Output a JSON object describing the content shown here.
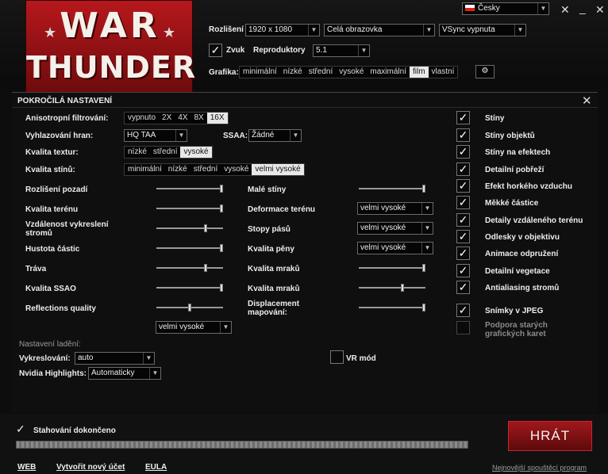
{
  "language": {
    "label": "Česky"
  },
  "header": {
    "logo_line1": "WAR",
    "logo_line2": "THUNDER",
    "resolution_label": "Rozlišení",
    "resolution_value": "1920 x 1080",
    "window_mode_value": "Celá obrazovka",
    "vsync_value": "VSync vypnuta",
    "sound_label": "Zvuk",
    "speakers_label": "Reproduktory",
    "speakers_value": "5.1",
    "graphics_label": "Grafika:",
    "graphics_presets": [
      "minimální",
      "nízké",
      "střední",
      "vysoké",
      "maximální",
      "film",
      "vlastní"
    ],
    "graphics_selected": "film"
  },
  "advanced": {
    "title": "POKROČILÁ NASTAVENÍ",
    "aniso_label": "Anisotropní filtrování:",
    "aniso_options": [
      "vypnuto",
      "2X",
      "4X",
      "8X",
      "16X"
    ],
    "aniso_selected": "16X",
    "aa_label": "Vyhlazování hran:",
    "aa_value": "HQ TAA",
    "ssaa_label": "SSAA:",
    "ssaa_value": "Žádné",
    "texture_label": "Kvalita textur:",
    "texture_options": [
      "nízké",
      "střední",
      "vysoké"
    ],
    "texture_selected": "vysoké",
    "shadow_label": "Kvalita stínů:",
    "shadow_options": [
      "minimální",
      "nízké",
      "střední",
      "vysoké",
      "velmi vysoké"
    ],
    "shadow_selected": "velmi vysoké",
    "left_sliders": [
      {
        "label": "Rozlišení pozadí",
        "value": 1.0
      },
      {
        "label": "Kvalita terénu",
        "value": 1.0
      },
      {
        "label": "Vzdálenost vykreslení stromů",
        "value": 0.75
      },
      {
        "label": "Hustota částic",
        "value": 1.0
      },
      {
        "label": "Tráva",
        "value": 0.75
      },
      {
        "label": "Kvalita SSAO",
        "value": 1.0
      },
      {
        "label": "Reflections quality",
        "value": 0.5
      }
    ],
    "reflections_value": "velmi vysoké",
    "mid": {
      "small_shadows_label": "Malé stíny",
      "small_shadows_value": 1.0,
      "terrain_deform_label": "Deformace terénu",
      "terrain_deform_value": "velmi vysoké",
      "tracks_label": "Stopy pásů",
      "tracks_value": "velmi vysoké",
      "foam_label": "Kvalita pěny",
      "foam_value": "velmi vysoké",
      "clouds1_label": "Kvalita mraků",
      "clouds1_value": 1.0,
      "clouds2_label": "Kvalita mraků",
      "clouds2_value": 0.66,
      "displacement_label": "Displacement mapování:",
      "displacement_value": 1.0
    },
    "checkboxes": [
      {
        "label": "Stíny",
        "checked": true
      },
      {
        "label": "Stíny objektů",
        "checked": true
      },
      {
        "label": "Stíny na efektech",
        "checked": true
      },
      {
        "label": "Detailní pobřeží",
        "checked": true
      },
      {
        "label": "Efekt horkého vzduchu",
        "checked": true
      },
      {
        "label": "Měkké částice",
        "checked": true
      },
      {
        "label": "Detaily vzdáleného terénu",
        "checked": true
      },
      {
        "label": "Odlesky v objektivu",
        "checked": true
      },
      {
        "label": "Animace odpružení",
        "checked": true
      },
      {
        "label": "Detailní vegetace",
        "checked": true
      },
      {
        "label": "Antialiasing stromů",
        "checked": true
      },
      {
        "label": "Snímky v JPEG",
        "checked": true
      },
      {
        "label": "Podpora starých grafických karet",
        "checked": false
      }
    ],
    "debug_label": "Nastavení ladění:",
    "render_label": "Vykreslování:",
    "render_value": "auto",
    "nvidia_label": "Nvidia Highlights:",
    "nvidia_value": "Automaticky",
    "vr_label": "VR mód"
  },
  "footer": {
    "download_status": "Stahování dokončeno",
    "progress": 1.0,
    "play_label": "HRÁT",
    "web_link": "WEB",
    "new_account_link": "Vytvořit nový účet",
    "eula_link": "EULA",
    "newest_launcher_link": "Nejnovější spouštěcí program"
  }
}
